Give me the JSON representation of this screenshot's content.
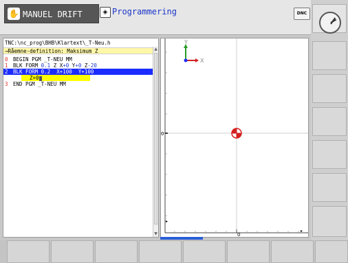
{
  "header": {
    "mode_label": "MANUEL DRIFT",
    "mode_icon": "hand-icon",
    "program_label": "Programmering",
    "program_icon": "edit-diamond-icon",
    "dnc_label": "DNC"
  },
  "program": {
    "path": "TNC:\\nc_prog\\BHB\\Klartext\\_T-Neu.h",
    "description": "→Råemne-definition: Maksimum Z",
    "lines": [
      {
        "num": "0",
        "text": "BEGIN PGM _T-NEU MM"
      },
      {
        "num": "1",
        "text": "BLK FORM 0.1 Z X+0 Y+0 Z-20"
      },
      {
        "num": "2",
        "text": "BLK FORM 0.2  X+100  Y+100"
      },
      {
        "num": "",
        "text": ""
      },
      {
        "num": "3",
        "text": "END PGM _T-NEU MM"
      }
    ],
    "line1_parts": {
      "a": "BLK FORM ",
      "b": "0.1",
      "c": " Z X",
      "d": "+0",
      "e": " Y",
      "f": "+0",
      "g": " Z",
      "h": "-20"
    },
    "editing_value": "Z+0"
  },
  "graphic": {
    "axis_y_label": "Y",
    "axis_x_label": "X",
    "ruler_zero_left": "0",
    "ruler_zero_bottom": "0"
  },
  "colors": {
    "accent_blue": "#1b2cff",
    "highlight_yellow": "#ffff00",
    "description_bg": "#fff7a8",
    "line_number_red": "#e53030"
  }
}
